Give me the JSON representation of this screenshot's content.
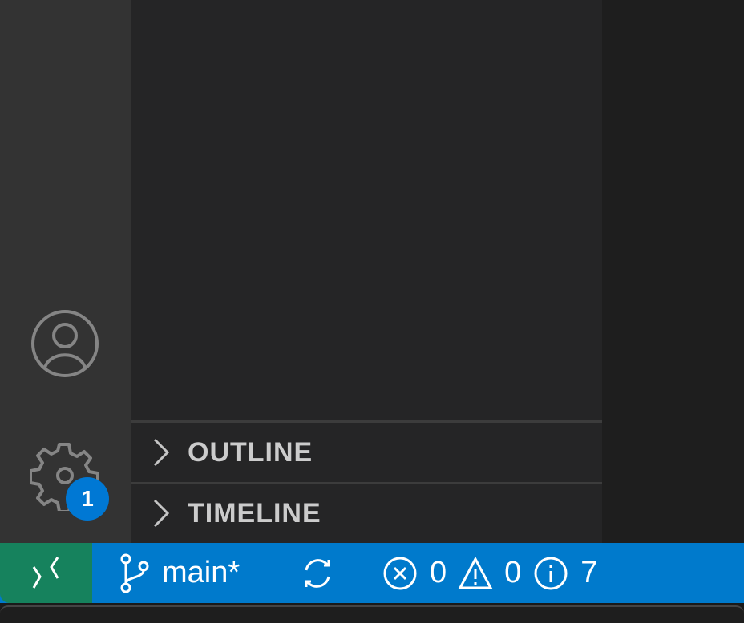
{
  "activity_bar": {
    "accounts_icon": "account-icon",
    "manage_icon": "gear-icon",
    "manage_badge": "1"
  },
  "sidebar": {
    "sections": [
      {
        "label": "OUTLINE",
        "expanded": false
      },
      {
        "label": "TIMELINE",
        "expanded": false
      }
    ]
  },
  "status_bar": {
    "remote_icon": "remote-icon",
    "branch": "main*",
    "sync_icon": "sync-icon",
    "errors": "0",
    "warnings": "0",
    "infos": "7"
  },
  "colors": {
    "status_bar": "#007acc",
    "remote": "#16825d",
    "badge": "#0078d4"
  }
}
